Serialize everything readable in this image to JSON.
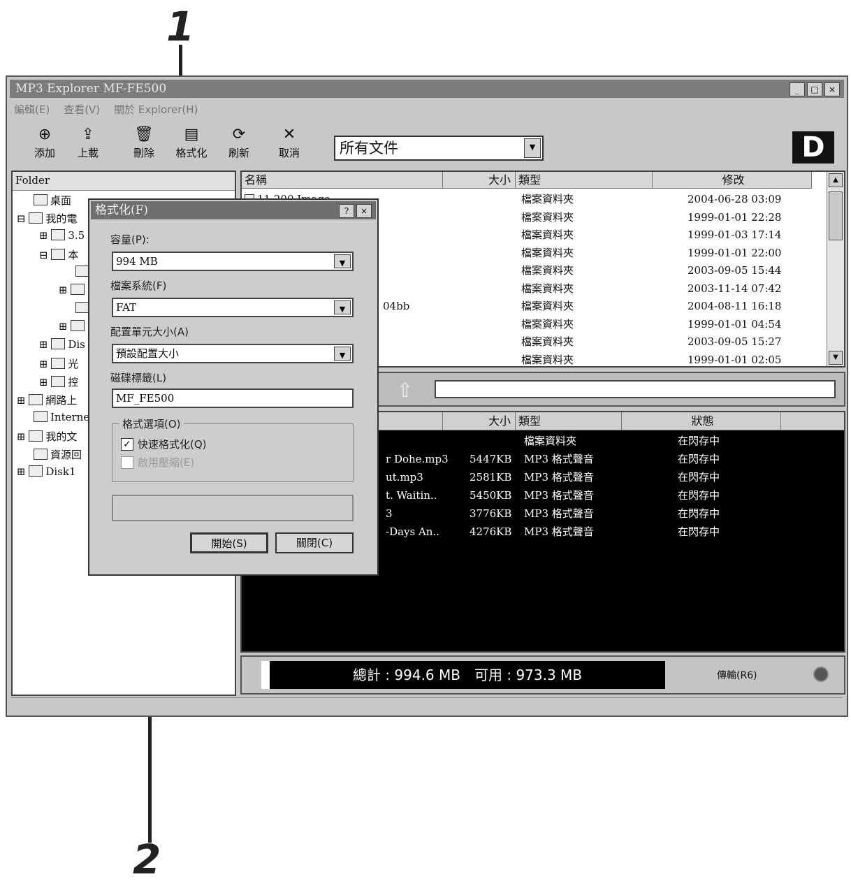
{
  "callouts": {
    "top": "1",
    "bottom": "2"
  },
  "window": {
    "title": "MP3 Explorer MF-FE500",
    "menu": [
      "編輯(E)",
      "查看(V)",
      "關於 Explorer(H)"
    ],
    "buttons": {
      "minimize": "_",
      "maximize": "□",
      "close": "×"
    }
  },
  "toolbar": {
    "buttons": [
      {
        "label": "添加",
        "icon": "add-file-icon",
        "glyph": "⊕"
      },
      {
        "label": "上載",
        "icon": "upload-icon",
        "glyph": "⇪"
      },
      {
        "label": "刪除",
        "icon": "trash-icon",
        "glyph": "🗑"
      },
      {
        "label": "格式化",
        "icon": "format-icon",
        "glyph": "▤"
      },
      {
        "label": "刷新",
        "icon": "refresh-icon",
        "glyph": "⟳"
      },
      {
        "label": "取消",
        "icon": "cancel-icon",
        "glyph": "✕"
      }
    ],
    "filter_value": "所有文件",
    "logo": "D"
  },
  "folders": {
    "header": "Folder",
    "items": [
      "桌面",
      "我的電",
      "3.5",
      "本",
      "",
      "",
      "",
      "",
      "Dis",
      "光",
      "控",
      "網路上",
      "Interne",
      "我的文",
      "資源回",
      "Disk1"
    ]
  },
  "files": {
    "columns": [
      "名稱",
      "大小",
      "類型",
      "修改"
    ],
    "rows": [
      {
        "name": "11 200 Image",
        "type": "檔案資料夾",
        "modified": "2004-06-28 03:09"
      },
      {
        "name": "",
        "type": "檔案資料夾",
        "modified": "1999-01-01 22:28"
      },
      {
        "name": "",
        "type": "檔案資料夾",
        "modified": "1999-01-03 17:14"
      },
      {
        "name": "",
        "type": "檔案資料夾",
        "modified": "1999-01-01 22:00"
      },
      {
        "name": "",
        "type": "檔案資料夾",
        "modified": "2003-09-05 15:44"
      },
      {
        "name": "",
        "type": "檔案資料夾",
        "modified": "2003-11-14 07:42"
      },
      {
        "name": "04bb",
        "type": "檔案資料夾",
        "modified": "2004-08-11 16:18"
      },
      {
        "name": "",
        "type": "檔案資料夾",
        "modified": "1999-01-01 04:54"
      },
      {
        "name": "",
        "type": "檔案資料夾",
        "modified": "2003-09-05 15:27"
      },
      {
        "name": "",
        "type": "檔案資料夾",
        "modified": "1999-01-01 02:05"
      }
    ]
  },
  "device": {
    "columns": [
      "",
      "大小",
      "類型",
      "狀態"
    ],
    "rows": [
      {
        "name": "",
        "size": "",
        "type": "檔案資料夾",
        "status": "在閃存中"
      },
      {
        "name": "r Dohe.mp3",
        "size": "5447KB",
        "type": "MP3 格式聲音",
        "status": "在閃存中"
      },
      {
        "name": "ut.mp3",
        "size": "2581KB",
        "type": "MP3 格式聲音",
        "status": "在閃存中"
      },
      {
        "name": "t. Waitin..",
        "size": "5450KB",
        "type": "MP3 格式聲音",
        "status": "在閃存中"
      },
      {
        "name": "3",
        "size": "3776KB",
        "type": "MP3 格式聲音",
        "status": "在閃存中"
      },
      {
        "name": "-Days An..",
        "size": "4276KB",
        "type": "MP3 格式聲音",
        "status": "在閃存中"
      }
    ],
    "capacity_text": "總計 : 994.6 MB　可用 : 973.3 MB",
    "mode_label": "傳輸(R6)"
  },
  "format_dialog": {
    "title": "格式化(F)",
    "help_btn": "?",
    "close_btn": "×",
    "capacity_label": "容量(P):",
    "capacity_value": "994 MB",
    "fs_label": "檔案系統(F)",
    "fs_value": "FAT",
    "alloc_label": "配置單元大小(A)",
    "alloc_value": "預設配置大小",
    "volume_label": "磁碟標籤(L)",
    "volume_value": "MF_FE500",
    "options_label": "格式選項(O)",
    "quick_format": "快速格式化(Q)",
    "quick_checked": "✓",
    "compression": "啟用壓縮(E)",
    "start_btn": "開始(S)",
    "close_btn_label": "關閉(C)"
  }
}
